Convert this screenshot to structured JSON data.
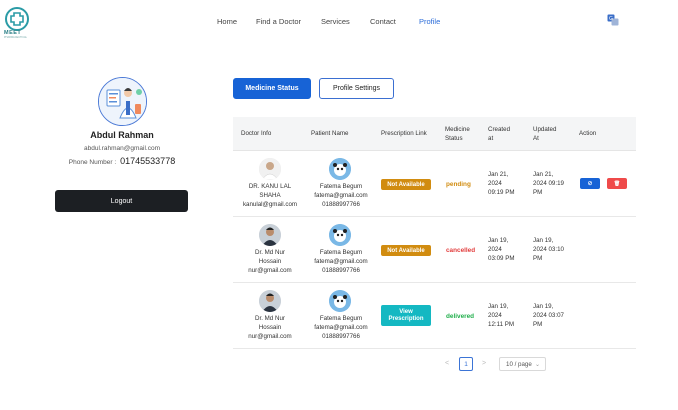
{
  "brand": {
    "name": "MEET",
    "tagline": "PHARMACEUTICAL"
  },
  "nav": {
    "items": [
      "Home",
      "Find a Doctor",
      "Services",
      "Contact",
      "Profile"
    ],
    "active": "Profile"
  },
  "icons": {
    "translate": "translate-icon",
    "avatar": "doctor-avatar-icon"
  },
  "profile": {
    "name": "Abdul Rahman",
    "email": "abdul.rahman@gmail.com",
    "phone_label": "Phone Number :",
    "phone": "01745533778",
    "logout_label": "Logout"
  },
  "tabs": {
    "medicine_status": "Medicine Status",
    "profile_settings": "Profile Settings"
  },
  "table": {
    "headers": {
      "doctor_info": "Doctor Info",
      "patient_name": "Patient Name",
      "prescription_link": "Prescription Link",
      "medicine_status": [
        "Medicine",
        "Status"
      ],
      "created_at": [
        "Created",
        "at"
      ],
      "updated_at": [
        "Updated",
        "At"
      ],
      "action": "Action"
    },
    "rows": [
      {
        "doctor": [
          "DR. KANU LAL",
          "SHAHA",
          "kanulal@gmail.com"
        ],
        "patient": [
          "Fatema Begum",
          "fatema@gmail.com",
          "01888997766"
        ],
        "prescription": "Not Available",
        "status": "pending",
        "created": [
          "Jan 21,",
          "2024",
          "09:19 PM"
        ],
        "updated": [
          "Jan 21,",
          "2024 09:19",
          "PM"
        ]
      },
      {
        "doctor": [
          "Dr. Md Nur",
          "Hossain",
          "nur@gmail.com"
        ],
        "patient": [
          "Fatema Begum",
          "fatema@gmail.com",
          "01888997766"
        ],
        "prescription": "Not Available",
        "status": "cancelled",
        "created": [
          "Jan 19,",
          "2024",
          "03:09 PM"
        ],
        "updated": [
          "Jan 19,",
          "2024 03:10",
          "PM"
        ]
      },
      {
        "doctor": [
          "Dr. Md Nur",
          "Hossain",
          "nur@gmail.com"
        ],
        "patient": [
          "Fatema Begum",
          "fatema@gmail.com",
          "01888997766"
        ],
        "prescription": [
          "View",
          "Prescription"
        ],
        "status": "delivered",
        "created": [
          "Jan 19,",
          "2024",
          "12:11 PM"
        ],
        "updated": [
          "Jan 19,",
          "2024 03:07",
          "PM"
        ]
      }
    ],
    "actions": {
      "cancel_symbol": "⊘",
      "delete_symbol": "🗑"
    }
  },
  "pagination": {
    "prev": "<",
    "current": "1",
    "next": ">",
    "page_size": "10 / page"
  },
  "colors": {
    "primary": "#1763d6",
    "pending": "#d18c10",
    "cancelled": "#e23c3c",
    "delivered": "#1fae4a",
    "view": "#14b8c2",
    "danger": "#ef4a4a"
  }
}
